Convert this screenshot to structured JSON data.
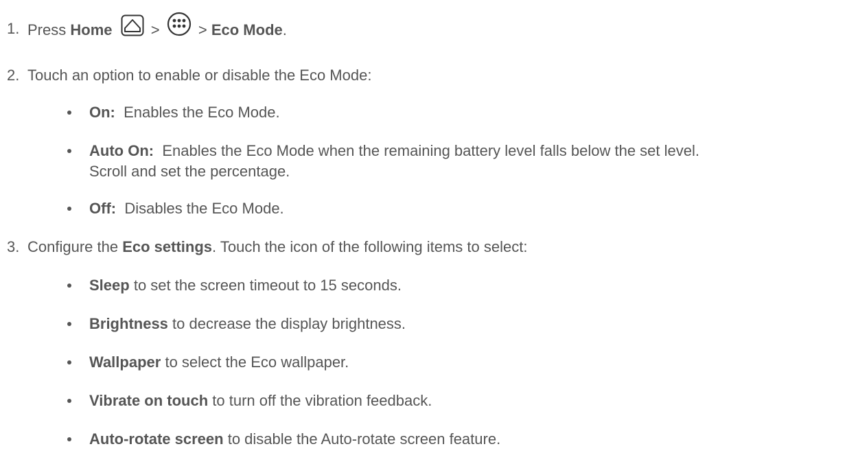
{
  "steps": [
    {
      "number": "1.",
      "parts": {
        "press": "Press",
        "home": "Home",
        "sep1": ">",
        "sep2": ">",
        "eco_mode": "Eco Mode",
        "period": "."
      },
      "icons": [
        "home-icon",
        "apps-icon"
      ]
    },
    {
      "number": "2.",
      "text": "Touch an option to enable or disable the Eco Mode:",
      "bullets": [
        {
          "label": "On:",
          "text": "Enables the Eco Mode."
        },
        {
          "label": "Auto On:",
          "text": "Enables the Eco Mode when the remaining battery level falls below the set level.",
          "text2": "Scroll and set the percentage."
        },
        {
          "label": "Off:",
          "text": "Disables the Eco Mode."
        }
      ]
    },
    {
      "number": "3.",
      "parts": {
        "configure": "Configure the",
        "eco_settings": "Eco settings",
        "rest": ". Touch the icon of the following items to select:"
      },
      "bullets": [
        {
          "label": "Sleep",
          "text": "to set the screen timeout to 15 seconds."
        },
        {
          "label": "Brightness",
          "text": "to decrease the display brightness."
        },
        {
          "label": "Wallpaper",
          "text": "to select the Eco wallpaper."
        },
        {
          "label": "Vibrate on touch",
          "text": "to turn off the vibration feedback."
        },
        {
          "label": "Auto-rotate screen",
          "text": "to disable the Auto-rotate screen feature."
        }
      ]
    }
  ],
  "colors": {
    "text": "#555555",
    "background": "#ffffff"
  }
}
